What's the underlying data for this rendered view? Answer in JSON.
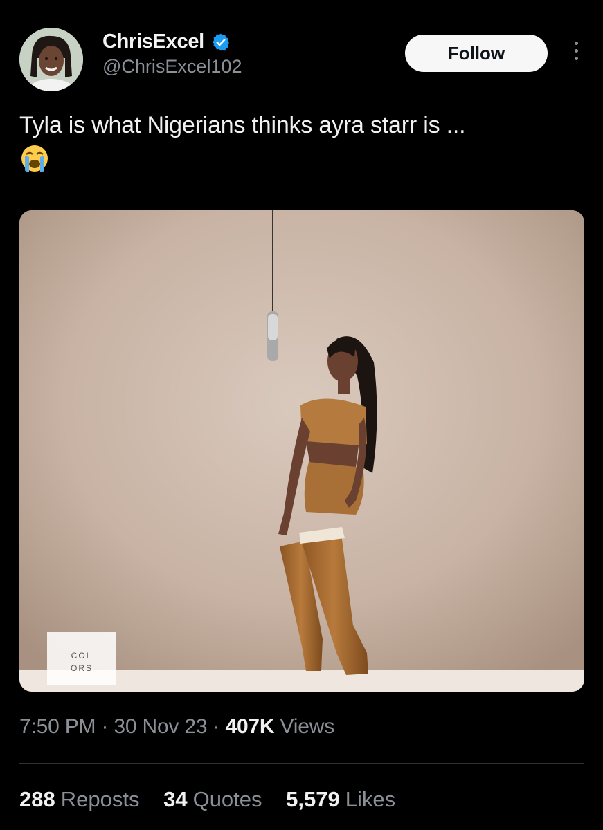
{
  "author": {
    "display_name": "ChrisExcel",
    "handle": "@ChrisExcel102",
    "verified": true,
    "verified_color": "#1d9bf0"
  },
  "actions": {
    "follow_label": "Follow",
    "more_icon": "more-vertical-icon"
  },
  "tweet": {
    "text": "Tyla is what Nigerians thinks ayra starr is ...",
    "emoji": "loudly-crying-face-emoji"
  },
  "media": {
    "watermark_line1": "COL",
    "watermark_line2": "ORS"
  },
  "meta": {
    "time": "7:50 PM",
    "date": "30 Nov 23",
    "views_count": "407K",
    "views_label": "Views",
    "separator": "·"
  },
  "stats": {
    "reposts_count": "288",
    "reposts_label": "Reposts",
    "quotes_count": "34",
    "quotes_label": "Quotes",
    "likes_count": "5,579",
    "likes_label": "Likes"
  },
  "colors": {
    "background": "#000000",
    "text_primary": "#e7e9ea",
    "text_secondary": "#8b9096",
    "divider": "#2f3336"
  }
}
